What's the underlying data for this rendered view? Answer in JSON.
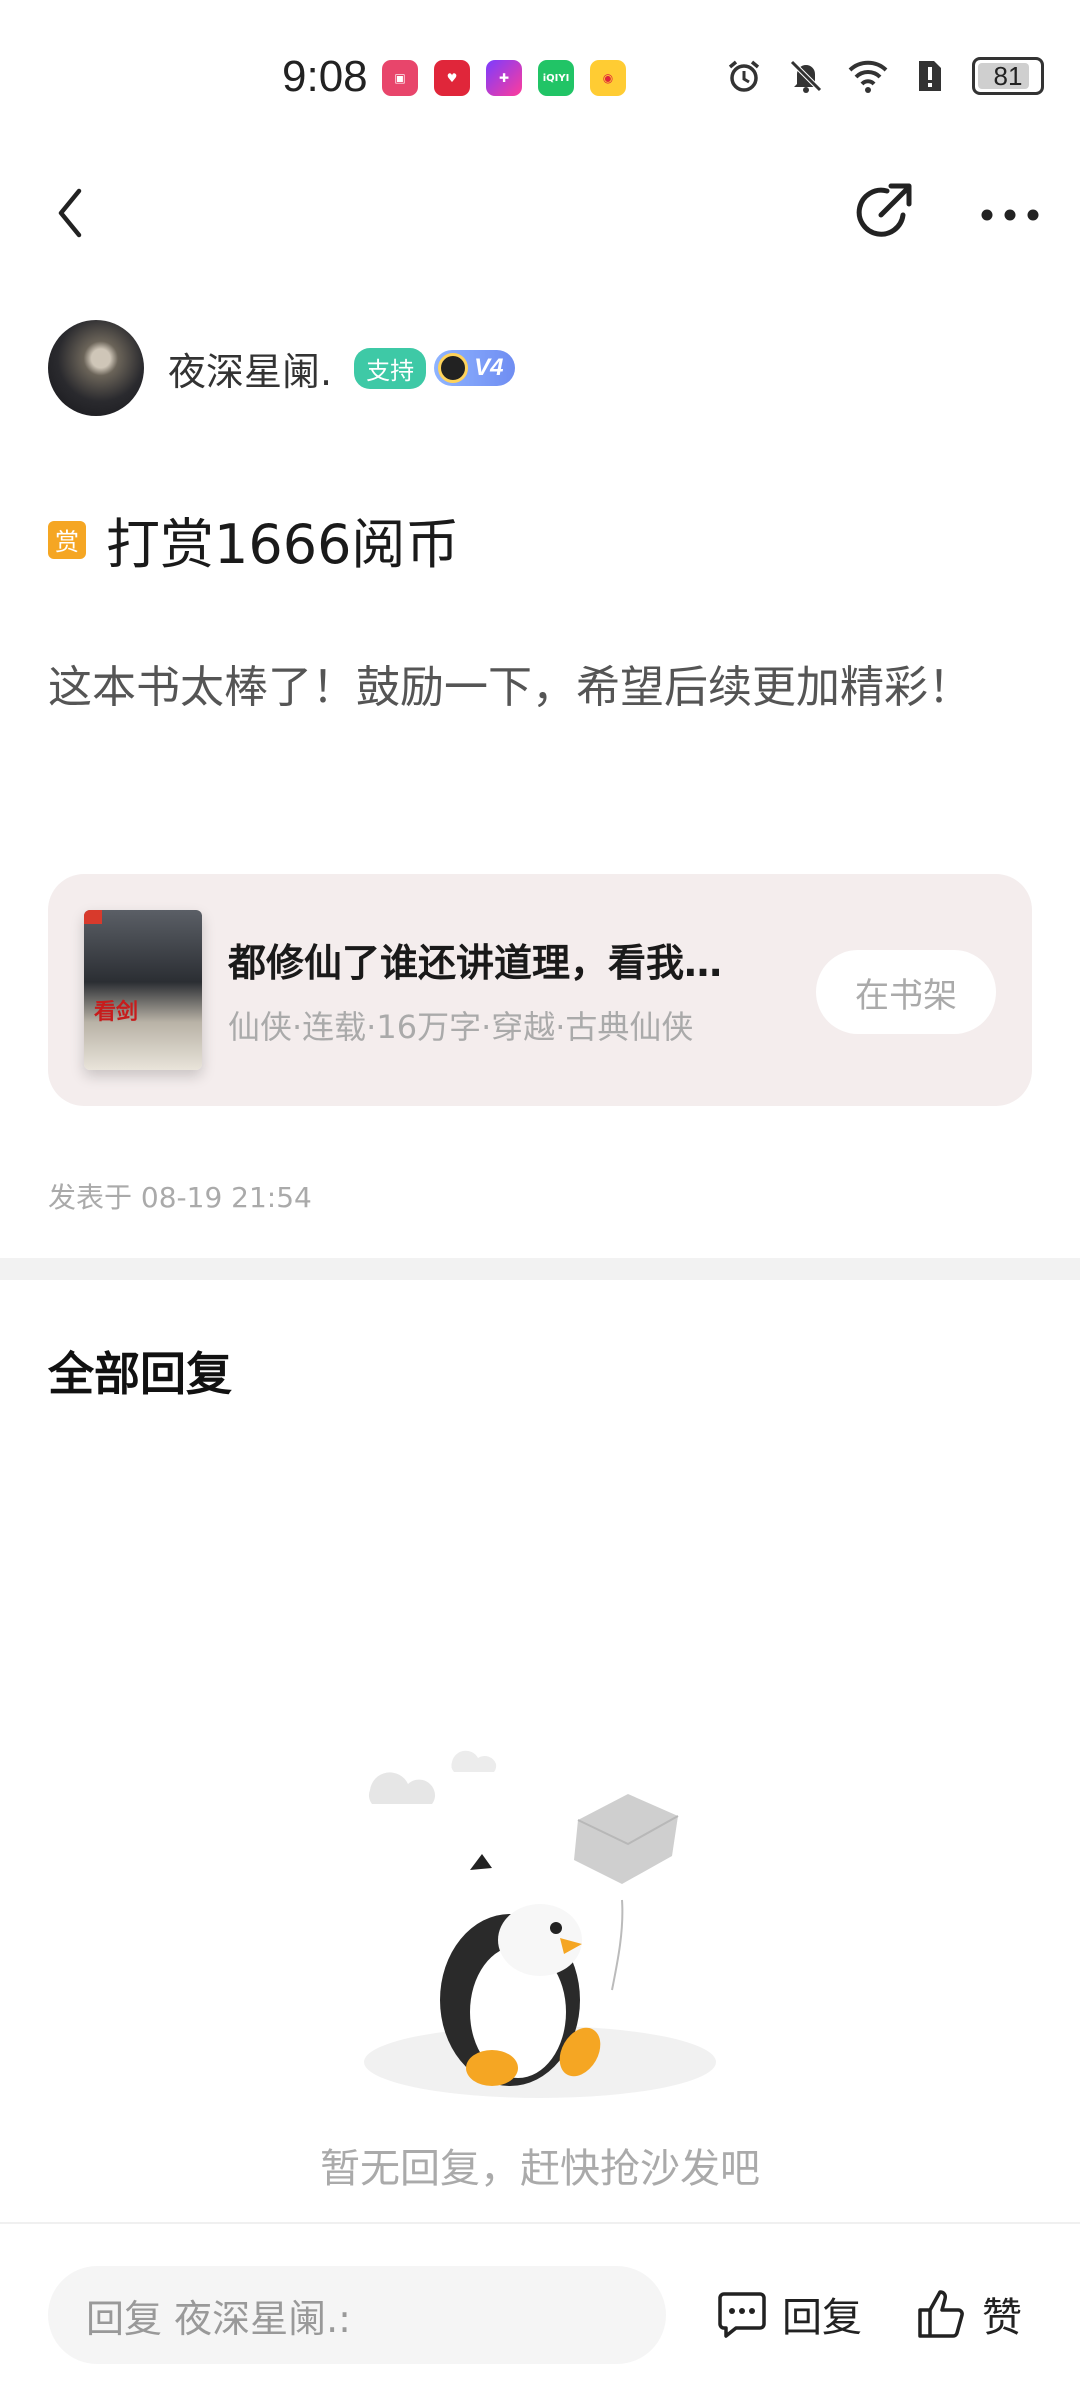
{
  "status_bar": {
    "time": "9:08",
    "battery": "81",
    "app_icons": [
      "huawei-mall-icon",
      "heart-app-icon",
      "paint-app-icon",
      "iqiyi-icon",
      "weibo-icon"
    ],
    "iqiyi_label": "iQIYI"
  },
  "author": {
    "name": "夜深星阑.",
    "support_badge": "支持",
    "level_badge": "V4"
  },
  "post": {
    "reward_icon_label": "赏",
    "title": "打赏1666阅币",
    "body": "这本书太棒了！鼓励一下，希望后续更加精彩！",
    "time": "发表于 08-19 21:54"
  },
  "book": {
    "title": "都修仙了谁还讲道理，看我一剑破万法",
    "meta": "仙侠·连载·16万字·穿越·古典仙侠",
    "shelf_button": "在书架",
    "cover_text": "看剑"
  },
  "replies": {
    "title": "全部回复",
    "empty_text": "暂无回复，赶快抢沙发吧"
  },
  "bottom_bar": {
    "input_placeholder": "回复 夜深星阑.:",
    "reply_label": "回复",
    "like_label": "赞"
  },
  "colors": {
    "accent_green": "#3ec9a6",
    "reward_orange": "#f5a623",
    "card_bg": "#f4eded"
  }
}
